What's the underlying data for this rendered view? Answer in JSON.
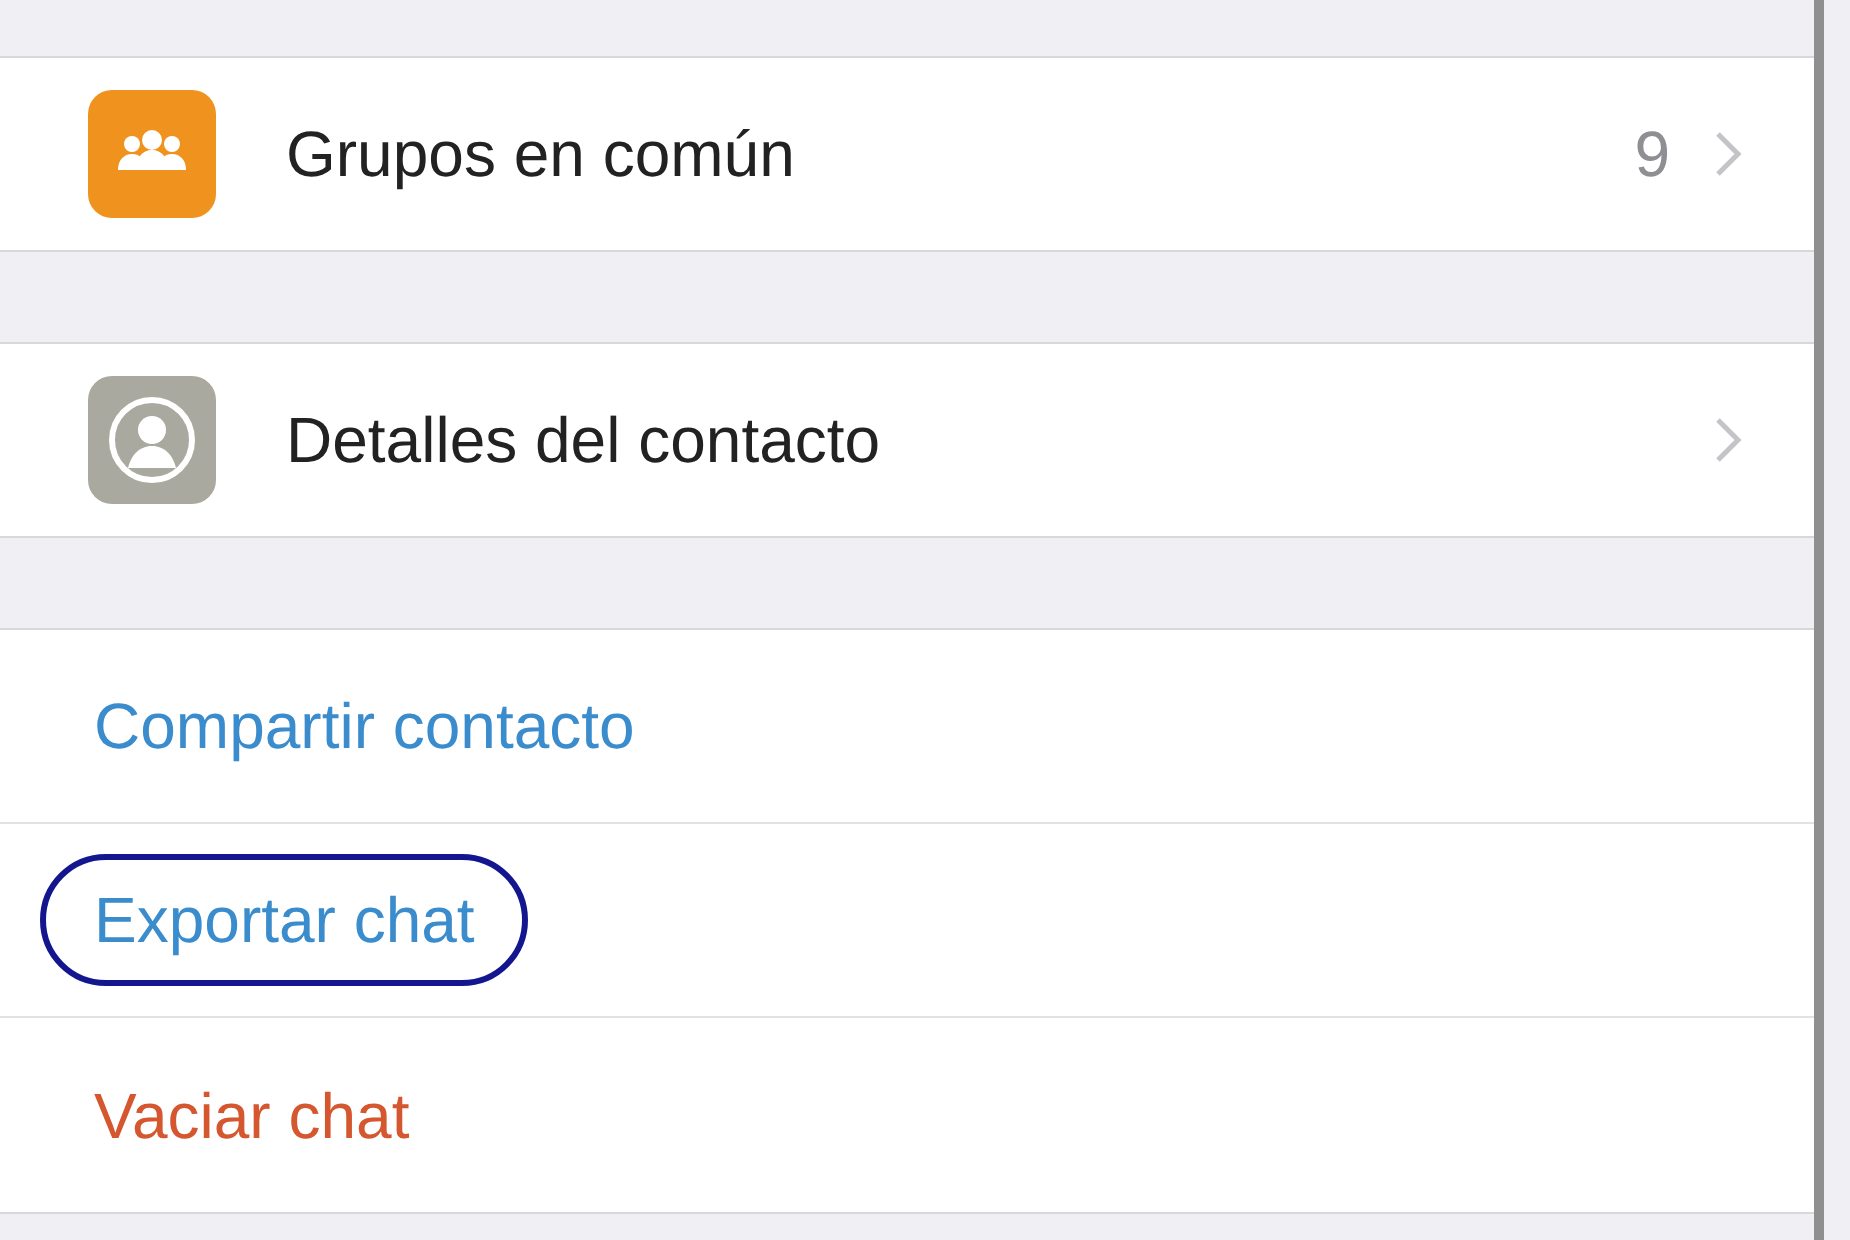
{
  "sections": [
    {
      "rows": [
        {
          "kind": "group",
          "label": "Grupos en común",
          "count": "9"
        }
      ]
    },
    {
      "rows": [
        {
          "kind": "contact",
          "label": "Detalles del contacto"
        }
      ]
    }
  ],
  "actions": [
    {
      "label": "Compartir contacto",
      "color": "#3a8ccd",
      "highlighted": false
    },
    {
      "label": "Exportar chat",
      "color": "#3a8ccd",
      "highlighted": true
    },
    {
      "label": "Vaciar chat",
      "color": "#d4572f",
      "highlighted": false
    }
  ]
}
